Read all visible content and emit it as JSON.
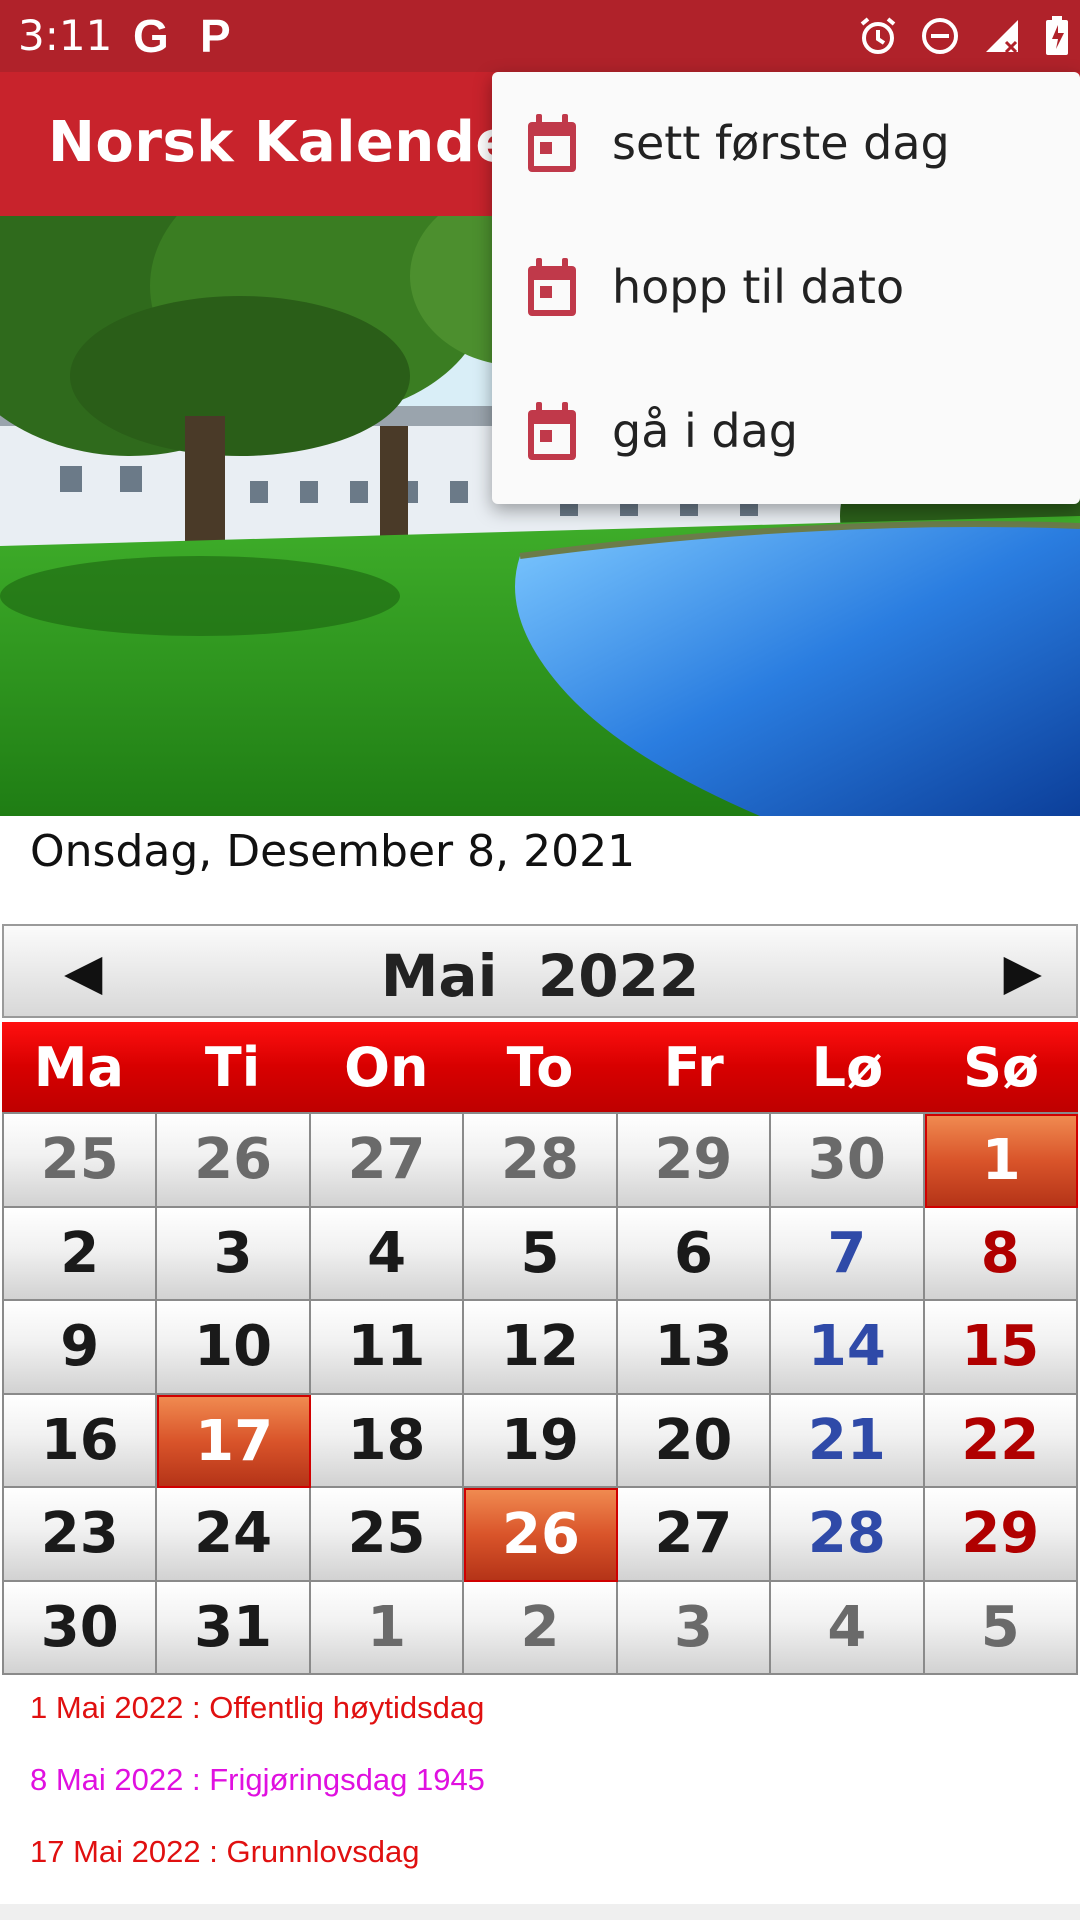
{
  "status_bar": {
    "time": "3:11",
    "left_icons": [
      "google-g-icon",
      "p-app-icon"
    ],
    "right_icons": [
      "alarm-icon",
      "do-not-disturb-icon",
      "signal-icon",
      "battery-charging-icon"
    ],
    "g_label": "G",
    "p_label": "P"
  },
  "app_bar": {
    "title": "Norsk Kalender",
    "color": "#c8232c"
  },
  "menu": {
    "items": [
      {
        "label": "sett første dag",
        "icon": "calendar-icon"
      },
      {
        "label": "hopp til dato",
        "icon": "calendar-icon"
      },
      {
        "label": "gå i dag",
        "icon": "calendar-icon"
      }
    ]
  },
  "today_text": "Onsdag, Desember 8, 2021",
  "calendar": {
    "prev_label": "◀",
    "next_label": "▶",
    "month_title": "Mai  2022",
    "weekdays": [
      "Ma",
      "Ti",
      "On",
      "To",
      "Fr",
      "Lø",
      "Sø"
    ],
    "weeks": [
      [
        {
          "d": "25",
          "t": "other"
        },
        {
          "d": "26",
          "t": "other"
        },
        {
          "d": "27",
          "t": "other"
        },
        {
          "d": "28",
          "t": "other"
        },
        {
          "d": "29",
          "t": "other"
        },
        {
          "d": "30",
          "t": "other"
        },
        {
          "d": "1",
          "t": "hl"
        }
      ],
      [
        {
          "d": "2",
          "t": ""
        },
        {
          "d": "3",
          "t": ""
        },
        {
          "d": "4",
          "t": ""
        },
        {
          "d": "5",
          "t": ""
        },
        {
          "d": "6",
          "t": ""
        },
        {
          "d": "7",
          "t": "sat"
        },
        {
          "d": "8",
          "t": "sun"
        }
      ],
      [
        {
          "d": "9",
          "t": ""
        },
        {
          "d": "10",
          "t": ""
        },
        {
          "d": "11",
          "t": ""
        },
        {
          "d": "12",
          "t": ""
        },
        {
          "d": "13",
          "t": ""
        },
        {
          "d": "14",
          "t": "sat"
        },
        {
          "d": "15",
          "t": "sun"
        }
      ],
      [
        {
          "d": "16",
          "t": ""
        },
        {
          "d": "17",
          "t": "hl"
        },
        {
          "d": "18",
          "t": ""
        },
        {
          "d": "19",
          "t": ""
        },
        {
          "d": "20",
          "t": ""
        },
        {
          "d": "21",
          "t": "sat"
        },
        {
          "d": "22",
          "t": "sun"
        }
      ],
      [
        {
          "d": "23",
          "t": ""
        },
        {
          "d": "24",
          "t": ""
        },
        {
          "d": "25",
          "t": ""
        },
        {
          "d": "26",
          "t": "hl"
        },
        {
          "d": "27",
          "t": ""
        },
        {
          "d": "28",
          "t": "sat"
        },
        {
          "d": "29",
          "t": "sun"
        }
      ],
      [
        {
          "d": "30",
          "t": ""
        },
        {
          "d": "31",
          "t": ""
        },
        {
          "d": "1",
          "t": "other"
        },
        {
          "d": "2",
          "t": "other"
        },
        {
          "d": "3",
          "t": "other"
        },
        {
          "d": "4",
          "t": "other"
        },
        {
          "d": "5",
          "t": "other"
        }
      ]
    ]
  },
  "holidays": [
    {
      "text": "1 Mai 2022 : Offentlig høytidsdag",
      "color": "#e01010"
    },
    {
      "text": "8 Mai 2022 : Frigjøringsdag 1945",
      "color": "#e010e0"
    },
    {
      "text": "17 Mai 2022 : Grunnlovsdag",
      "color": "#e01010"
    }
  ]
}
